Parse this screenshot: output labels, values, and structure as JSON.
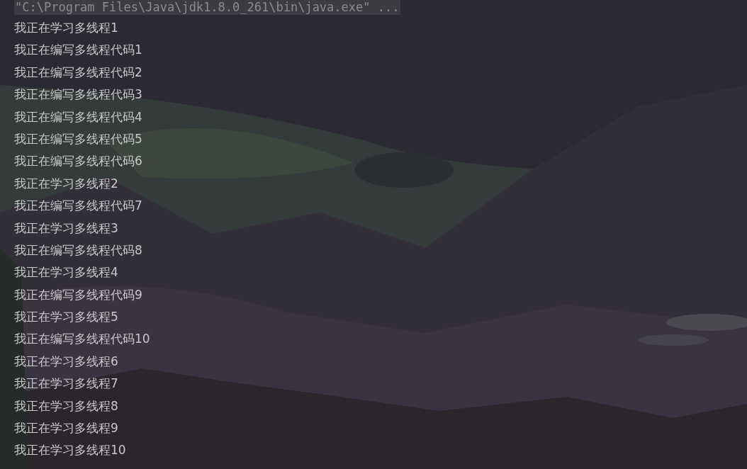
{
  "console": {
    "command": "\"C:\\Program Files\\Java\\jdk1.8.0_261\\bin\\java.exe\" ...",
    "lines": [
      "我正在学习多线程1",
      "我正在编写多线程代码1",
      "我正在编写多线程代码2",
      "我正在编写多线程代码3",
      "我正在编写多线程代码4",
      "我正在编写多线程代码5",
      "我正在编写多线程代码6",
      "我正在学习多线程2",
      "我正在编写多线程代码7",
      "我正在学习多线程3",
      "我正在编写多线程代码8",
      "我正在学习多线程4",
      "我正在编写多线程代码9",
      "我正在学习多线程5",
      "我正在编写多线程代码10",
      "我正在学习多线程6",
      "我正在学习多线程7",
      "我正在学习多线程8",
      "我正在学习多线程9",
      "我正在学习多线程10"
    ]
  }
}
